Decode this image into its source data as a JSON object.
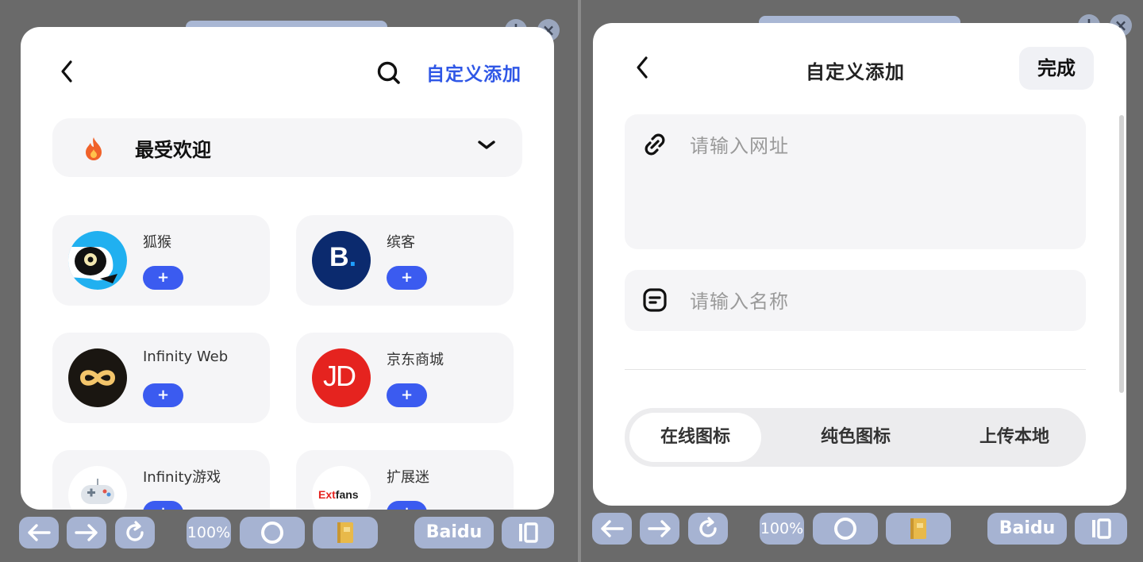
{
  "left": {
    "header": {
      "link": "自定义添加"
    },
    "category": {
      "label": "最受欢迎"
    },
    "apps": [
      {
        "name": "狐猴",
        "add": "+"
      },
      {
        "name": "缤客",
        "add": "+"
      },
      {
        "name": "Infinity Web",
        "add": "+"
      },
      {
        "name": "京东商城",
        "add": "+"
      },
      {
        "name": "Infinity游戏",
        "add": "+"
      },
      {
        "name": "扩展迷",
        "add": "+"
      }
    ],
    "logo_text": {
      "booking": "B.",
      "jd": "JD",
      "extfans_red": "Ext",
      "extfans_dark": "fans"
    }
  },
  "right": {
    "header": {
      "title": "自定义添加",
      "done": "完成"
    },
    "url_field": {
      "placeholder": "请输入网址"
    },
    "name_field": {
      "placeholder": "请输入名称"
    },
    "tabs": [
      "在线图标",
      "纯色图标",
      "上传本地"
    ],
    "active_tab": "在线图标"
  },
  "toolbar": {
    "zoom": "100%",
    "engine": "Baidu"
  },
  "colors": {
    "accent": "#2f57e6",
    "button": "#3b5bf0",
    "toolbar": "#a6b3d2",
    "card_bg": "#ffffff",
    "tile_bg": "#f5f5f7"
  },
  "icons": [
    "back-icon",
    "search-icon",
    "flame-icon",
    "chevron-down-icon",
    "link-icon",
    "name-icon",
    "arrow-left-icon",
    "arrow-right-icon",
    "refresh-icon",
    "circle-icon",
    "notebook-icon",
    "sidebar-icon",
    "plus-icon",
    "close-icon"
  ]
}
